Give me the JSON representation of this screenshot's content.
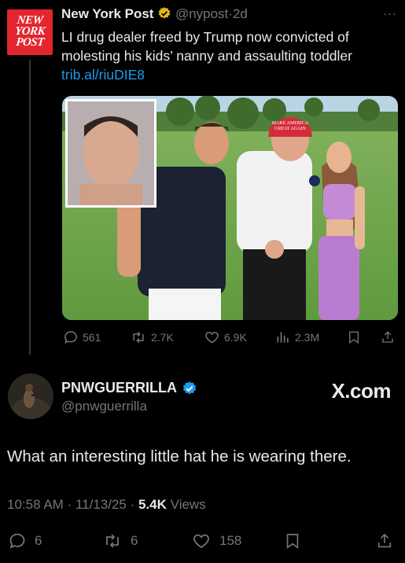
{
  "quoted_post": {
    "logo_lines": [
      "NEW",
      "YORK",
      "POST"
    ],
    "author_name": "New York Post",
    "handle": "@nypost",
    "separator": "·",
    "age": "2d",
    "text": "LI drug dealer freed by Trump now convicted of molesting his kids’ nanny and assaulting toddler",
    "link": "trib.al/riuDIE8",
    "more_icon": "ellipsis-icon",
    "photo_hat_text": [
      "MAKE AMERICA",
      "GREAT AGAIN"
    ],
    "actions": {
      "replies": "561",
      "reposts": "2.7K",
      "likes": "6.9K",
      "views": "2.3M"
    }
  },
  "main_post": {
    "author_name": "PNWGUERRILLA",
    "handle": "@pnwguerrilla",
    "watermark": "X.com",
    "text": "What an interesting little hat he is wearing there.",
    "time": "10:58 AM",
    "date": "11/13/25",
    "views_count": "5.4K",
    "views_label": "Views",
    "actions": {
      "replies": "6",
      "reposts": "6",
      "likes": "158"
    }
  },
  "colors": {
    "background": "#000000",
    "text": "#e7e9ea",
    "muted": "#71767b",
    "link": "#1d9bf0",
    "verified_gold": "#e2b719",
    "verified_blue": "#1d9bf0",
    "nypost_red": "#e3262d"
  }
}
